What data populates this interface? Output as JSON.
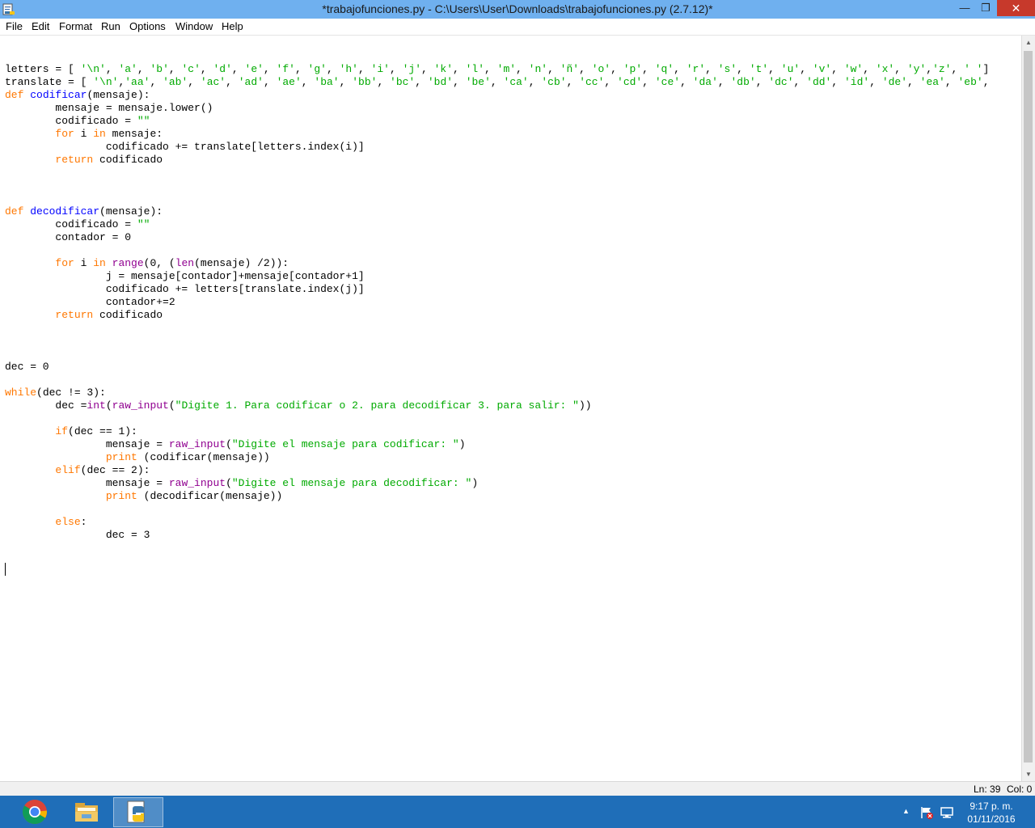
{
  "window": {
    "title": "*trabajofunciones.py - C:\\Users\\User\\Downloads\\trabajofunciones.py (2.7.12)*",
    "minimize_glyph": "—",
    "maximize_glyph": "❐",
    "close_glyph": "✕"
  },
  "menu": {
    "items": [
      "File",
      "Edit",
      "Format",
      "Run",
      "Options",
      "Window",
      "Help"
    ]
  },
  "editor": {
    "language": "python",
    "lines": [
      "",
      "letters = [ '\\n', 'a', 'b', 'c', 'd', 'e', 'f', 'g', 'h', 'i', 'j', 'k', 'l', 'm', 'n', 'ñ', 'o', 'p', 'q', 'r', 's', 't', 'u', 'v', 'w', 'x', 'y','z', ' ']",
      "translate = [ '\\n','aa', 'ab', 'ac', 'ad', 'ae', 'ba', 'bb', 'bc', 'bd', 'be', 'ca', 'cb', 'cc', 'cd', 'ce', 'da', 'db', 'dc', 'dd', 'id', 'de', 'ea', 'eb',",
      "def codificar(mensaje):",
      "        mensaje = mensaje.lower()",
      "        codificado = \"\"",
      "        for i in mensaje:",
      "                codificado += translate[letters.index(i)]",
      "        return codificado",
      "",
      "",
      "",
      "def decodificar(mensaje):",
      "        codificado = \"\"",
      "        contador = 0",
      "",
      "        for i in range(0, (len(mensaje) /2)):",
      "                j = mensaje[contador]+mensaje[contador+1]",
      "                codificado += letters[translate.index(j)]",
      "                contador+=2",
      "        return codificado",
      "",
      "",
      "",
      "dec = 0",
      "",
      "while(dec != 3):",
      "        dec =int(raw_input(\"Digite 1. Para codificar o 2. para decodificar 3. para salir: \"))",
      "",
      "        if(dec == 1):",
      "                mensaje = raw_input(\"Digite el mensaje para codificar: \")",
      "                print (codificar(mensaje))",
      "        elif(dec == 2):",
      "                mensaje = raw_input(\"Digite el mensaje para decodificar: \")",
      "                print (decodificar(mensaje))",
      "",
      "        else:",
      "                dec = 3",
      "",
      ""
    ],
    "colors": {
      "keyword": "#ff7700",
      "definition": "#0000ff",
      "builtin": "#900090",
      "string": "#00aa00"
    }
  },
  "status": {
    "ln": "Ln: 39",
    "col": "Col: 0"
  },
  "taskbar": {
    "apps": [
      {
        "name": "chrome-icon"
      },
      {
        "name": "file-explorer-icon"
      },
      {
        "name": "python-idle-icon",
        "active": true
      }
    ],
    "tray_arrow": "▲",
    "clock_time": "9:17 p. m.",
    "clock_date": "01/11/2016"
  }
}
